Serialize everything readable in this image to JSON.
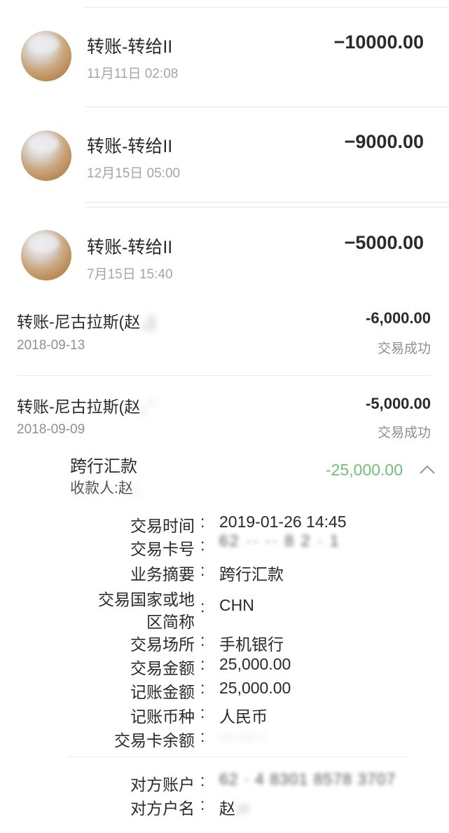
{
  "transfers": [
    {
      "title": "转账-转给II",
      "date": "11月11日 02:08",
      "amount": "−10000.00"
    },
    {
      "title": "转账-转给II",
      "date": "12月15日 05:00",
      "amount": "−9000.00"
    },
    {
      "title": "转账-转给II",
      "date": "7月15日 15:40",
      "amount": "−5000.00"
    }
  ],
  "records": [
    {
      "title": "转账-尼古拉斯(赵",
      "date": "2018-09-13",
      "amount": "-6,000.00",
      "status": "交易成功"
    },
    {
      "title": "转账-尼古拉斯(赵",
      "date": "2018-09-09",
      "amount": "-5,000.00",
      "status": "交易成功"
    }
  ],
  "remittance": {
    "title": "跨行汇款",
    "payee": "收款人:赵",
    "amount": "-25,000.00",
    "amount_color": "#6fbf7a",
    "chevron_icon": "chevron-up-icon"
  },
  "details": [
    {
      "label": "交易时间",
      "value": "2019-01-26 14:45"
    },
    {
      "label": "交易卡号",
      "value": "62 ·· ·· 8 2 · 1"
    },
    {
      "label": "业务摘要",
      "value": "跨行汇款"
    },
    {
      "label": "交易国家或地区简称",
      "label_line1": "交易国家或地",
      "label_line2": "区简称",
      "value": "CHN"
    },
    {
      "label": "交易场所",
      "value": "手机银行"
    },
    {
      "label": "交易金额",
      "value": "25,000.00"
    },
    {
      "label": "记账金额",
      "value": "25,000.00"
    },
    {
      "label": "记账币种",
      "value": "人民币"
    },
    {
      "label": "交易卡余额",
      "value": "··· ··· ·"
    }
  ],
  "counterparty": [
    {
      "label": "对方账户",
      "value": "62 · 4 8301 8578 3707"
    },
    {
      "label": "对方户名",
      "value": "赵"
    }
  ],
  "colon": ":"
}
